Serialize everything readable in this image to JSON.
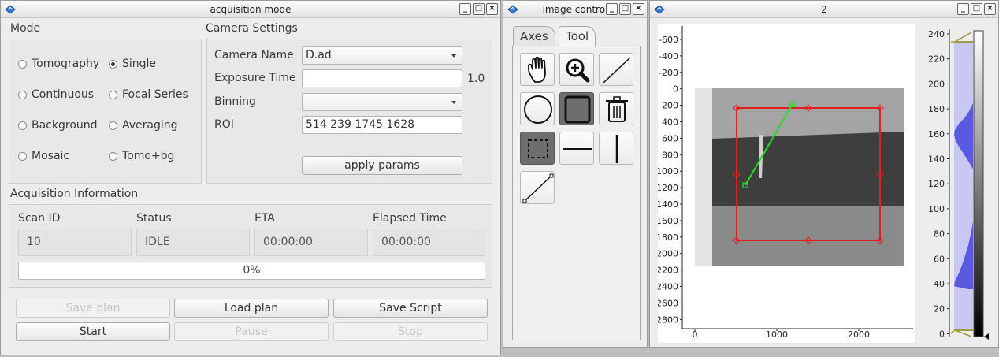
{
  "acq": {
    "title": "acquisition mode",
    "mode_label": "Mode",
    "modes": [
      {
        "label": "Tomography",
        "selected": false
      },
      {
        "label": "Single",
        "selected": true
      },
      {
        "label": "Continuous",
        "selected": false
      },
      {
        "label": "Focal Series",
        "selected": false
      },
      {
        "label": "Background",
        "selected": false
      },
      {
        "label": "Averaging",
        "selected": false
      },
      {
        "label": "Mosaic",
        "selected": false
      },
      {
        "label": "Tomo+bg",
        "selected": false
      }
    ],
    "camera_settings_label": "Camera Settings",
    "camera_name_label": "Camera Name",
    "camera_name_value": "D.ad",
    "exposure_label": "Exposure Time",
    "exposure_value": "",
    "exposure_suffix": "1.0",
    "binning_label": "Binning",
    "binning_value": "",
    "roi_label": "ROI",
    "roi_value": "514 239 1745 1628",
    "apply_label": "apply params",
    "info_label": "Acquisition Information",
    "scan_id_label": "Scan ID",
    "scan_id_value": "10",
    "status_label": "Status",
    "status_value": "IDLE",
    "eta_label": "ETA",
    "eta_value": "00:00:00",
    "elapsed_label": "Elapsed Time",
    "elapsed_value": "00:00:00",
    "progress_text": "0%",
    "progress_value": 0,
    "buttons": {
      "save_plan": "Save plan",
      "load_plan": "Load plan",
      "save_script": "Save Script",
      "start": "Start",
      "pause": "Pause",
      "stop": "Stop"
    }
  },
  "imgctl": {
    "title": "image control",
    "tabs": [
      "Axes",
      "Tool"
    ],
    "active_tab": "Tool",
    "tools": [
      "pan-icon",
      "zoom-icon",
      "line-icon",
      "circle-icon",
      "rectangle-icon",
      "trash-icon",
      "rect-select-icon",
      "hline-icon",
      "vline-icon",
      "segment-icon"
    ],
    "active_tool": "rectangle-icon"
  },
  "plot": {
    "title": "2",
    "y_ticks": [
      "-600",
      "-400",
      "-200",
      "0",
      "200",
      "400",
      "600",
      "800",
      "1000",
      "1200",
      "1400",
      "1600",
      "1800",
      "2000",
      "2200",
      "2400",
      "2600",
      "2800"
    ],
    "x_ticks": [
      "0",
      "1000",
      "2000"
    ],
    "hist_ticks": [
      "240",
      "220",
      "200",
      "180",
      "160",
      "140",
      "120",
      "100",
      "80",
      "60",
      "40",
      "20",
      "0"
    ]
  },
  "colors": {
    "roi": "#e02020",
    "line": "#22dd22",
    "histogram": "#5a5ae0"
  }
}
